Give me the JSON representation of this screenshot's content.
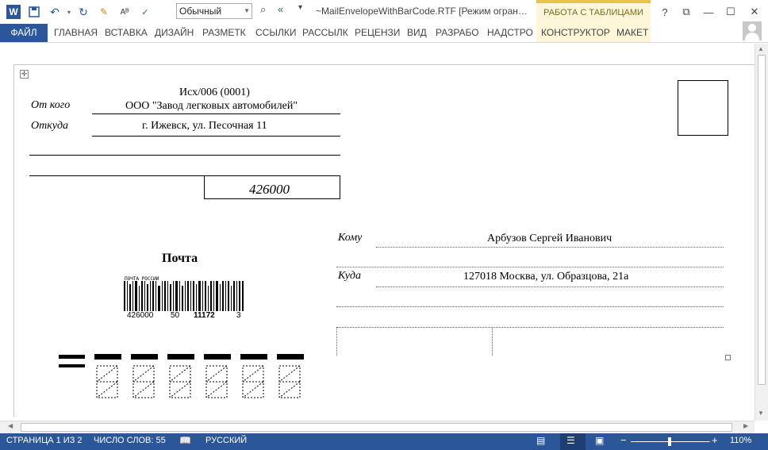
{
  "titlebar": {
    "word_logo": "W",
    "style_name": "Обычный",
    "doc_title": "~MailEnvelopeWithBarCode.RTF [Режим огран…",
    "context_header": "РАБОТА С ТАБЛИЦАМИ",
    "help": "?",
    "restore_ribbon": "⧉",
    "minimize": "—",
    "maximize": "☐",
    "close": "✕"
  },
  "ribbon": {
    "tabs": [
      "ФАЙЛ",
      "ГЛАВНАЯ",
      "ВСТАВКА",
      "ДИЗАЙН",
      "РАЗМЕТК",
      "ССЫЛКИ",
      "РАССЫЛК",
      "РЕЦЕНЗИ",
      "ВИД",
      "РАЗРАБО",
      "НАДСТРО",
      "КОНСТРУКТОР",
      "МАКЕТ"
    ]
  },
  "envelope": {
    "outgoing_no": "Исх/006 (0001)",
    "from_label": "От кого",
    "from_value": "ООО \"Завод легковых автомобилей\"",
    "from_addr_label": "Откуда",
    "from_addr_value": "г. Ижевск, ул. Песочная 11",
    "sender_index": "426000",
    "to_label": "Кому",
    "to_value": "Арбузов Сергей Иванович",
    "to_addr_label": "Куда",
    "to_addr_value": "127018 Москва, ул. Образцова, 21а",
    "post_label": "Почта",
    "barcode_header": "ПОЧТА РОССИИ",
    "barcode_index": "426000",
    "barcode_num1": "50",
    "barcode_num2": "11172",
    "barcode_num3": "3"
  },
  "statusbar": {
    "page": "СТРАНИЦА 1 ИЗ 2",
    "words": "ЧИСЛО СЛОВ: 55",
    "language": "РУССКИЙ",
    "zoom_minus": "−",
    "zoom_plus": "+",
    "zoom": "110%",
    "zoom_level_percent": 110
  },
  "colors": {
    "accent": "#2b579a",
    "context_tab": "#fdf6d9",
    "context_border": "#e8c34a"
  }
}
